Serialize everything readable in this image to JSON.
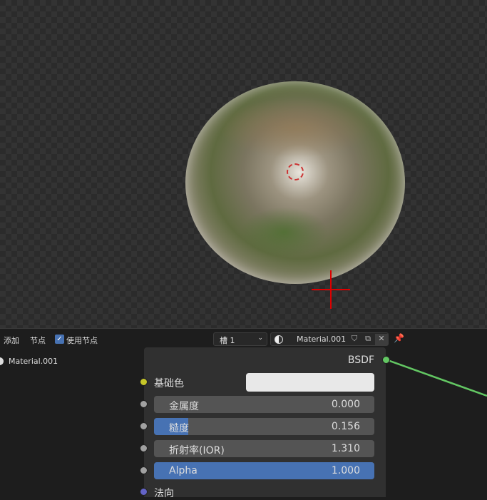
{
  "header": {
    "add": "添加",
    "node": "节点",
    "use_nodes": "使用节点",
    "use_nodes_checked": true,
    "slot": "槽 1",
    "material": "Material.001"
  },
  "left": {
    "material": "Material.001"
  },
  "node": {
    "output": "BSDF",
    "base_color_label": "基础色",
    "base_color": "#e8e8e8",
    "fields": [
      {
        "label": "金属度",
        "value": "0.000",
        "fraction": 0
      },
      {
        "label": "糙度",
        "value": "0.156",
        "fraction": 0.156
      },
      {
        "label": "折射率(IOR)",
        "value": "1.310",
        "fraction": 0
      },
      {
        "label": "Alpha",
        "value": "1.000",
        "fraction": 1
      }
    ],
    "normal_label": "法向"
  },
  "colors": {
    "accent": "#4772b3",
    "shader_socket": "#63c763",
    "color_socket": "#c7c729",
    "float_socket": "#a1a1a1",
    "vector_socket": "#6363c7"
  }
}
